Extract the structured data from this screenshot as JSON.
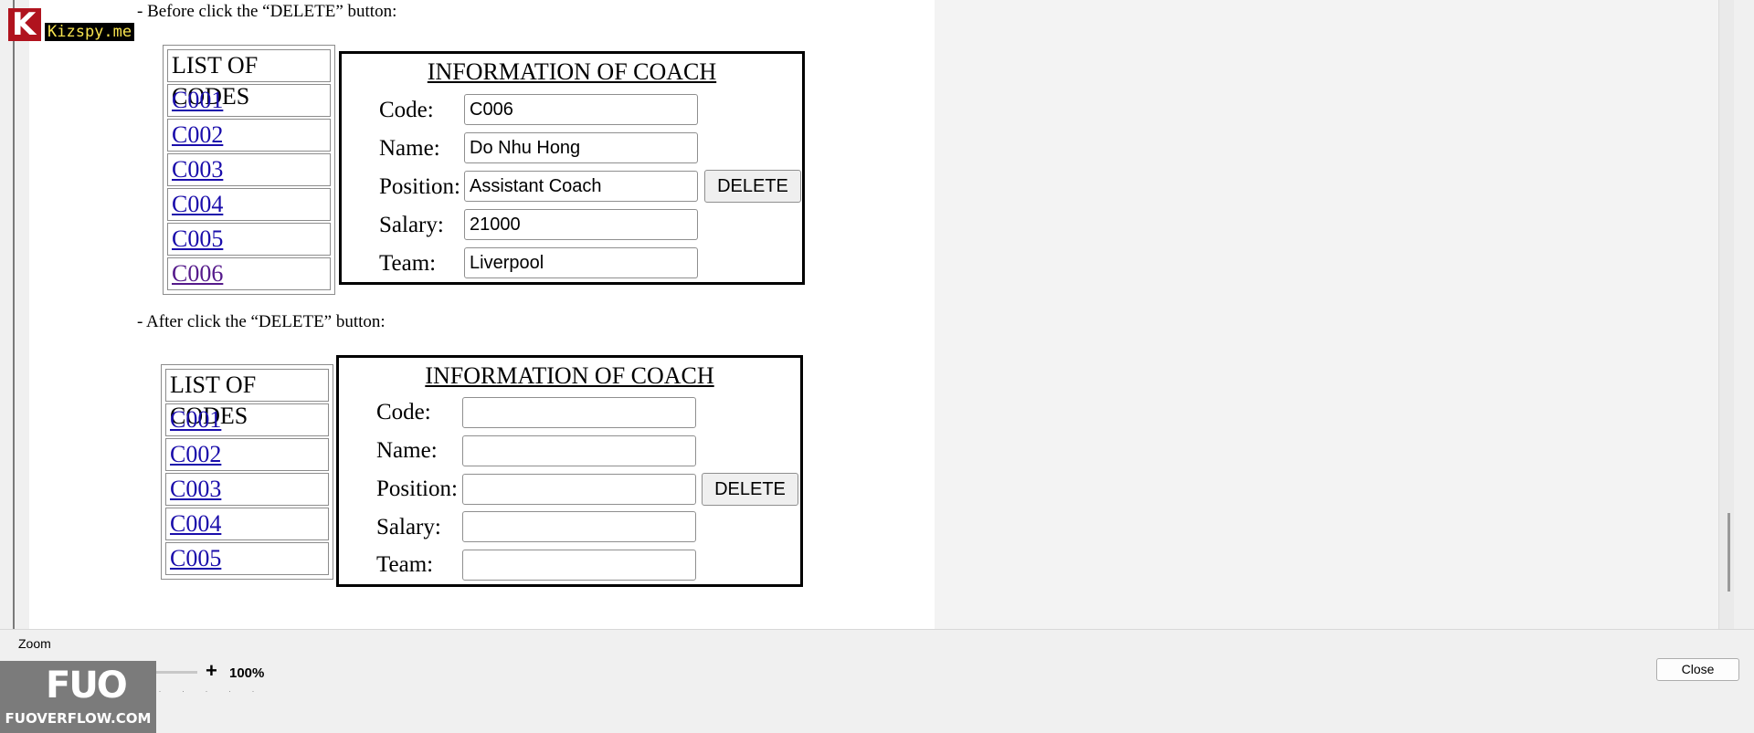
{
  "watermark": {
    "top_logo_letter": "K",
    "top_logo_text": "Kizspy.me",
    "bottom_logo": "FUO",
    "bottom_text": "FUOVERFLOW.COM"
  },
  "captions": {
    "before": "- Before click the “DELETE” button:",
    "after": "- After click the “DELETE” button:"
  },
  "before": {
    "codes_header": "LIST OF CODES",
    "codes": [
      "C001",
      "C002",
      "C003",
      "C004",
      "C005",
      "C006"
    ],
    "arrow": "-->",
    "info_title": "INFORMATION OF COACH",
    "labels": {
      "code": "Code:",
      "name": "Name:",
      "position": "Position:",
      "salary": "Salary:",
      "team": "Team:"
    },
    "values": {
      "code": "C006",
      "name": "Do Nhu Hong",
      "position": "Assistant Coach",
      "salary": "21000",
      "team": "Liverpool"
    },
    "delete_label": "DELETE"
  },
  "after": {
    "codes_header": "LIST OF CODES",
    "codes": [
      "C001",
      "C002",
      "C003",
      "C004",
      "C005"
    ],
    "arrow": "-->",
    "info_title": "INFORMATION OF COACH",
    "labels": {
      "code": "Code:",
      "name": "Name:",
      "position": "Position:",
      "salary": "Salary:",
      "team": "Team:"
    },
    "values": {
      "code": "",
      "name": "",
      "position": "",
      "salary": "",
      "team": ""
    },
    "delete_label": "DELETE"
  },
  "zoom": {
    "label": "Zoom",
    "minus": "-",
    "plus": "+",
    "value": "100%"
  },
  "close_label": "Close"
}
